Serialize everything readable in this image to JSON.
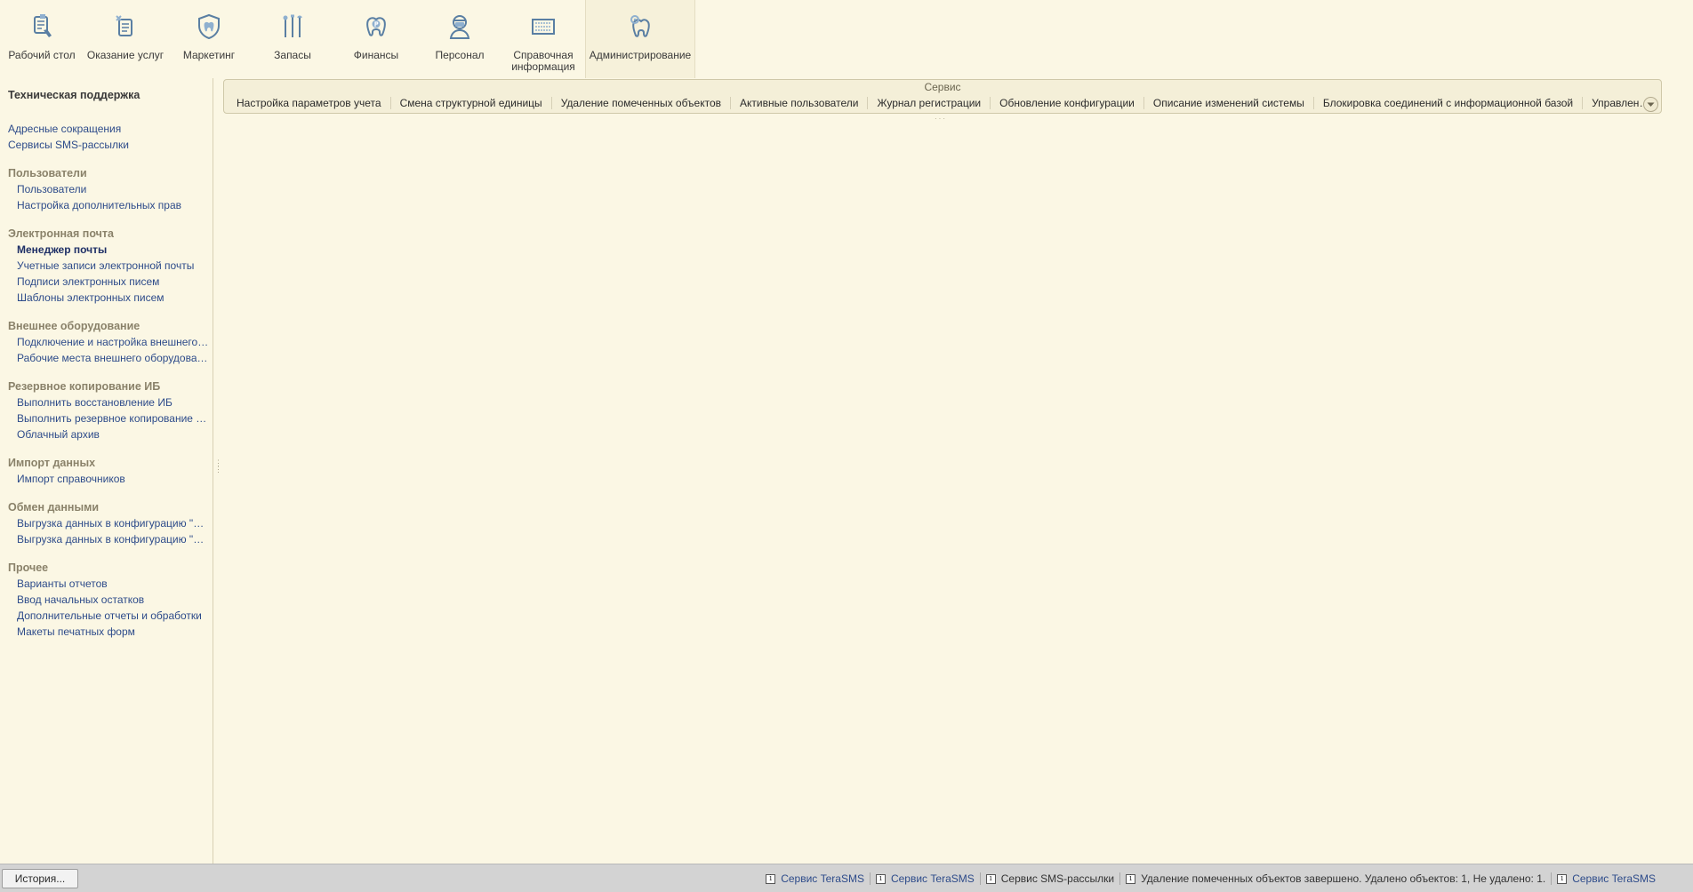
{
  "sections": [
    {
      "id": "desktop",
      "label": "Рабочий стол",
      "icon": "desktop-icon"
    },
    {
      "id": "services",
      "label": "Оказание услуг",
      "icon": "dental-services-icon"
    },
    {
      "id": "marketing",
      "label": "Маркетинг",
      "icon": "shield-tooth-icon"
    },
    {
      "id": "stock",
      "label": "Запасы",
      "icon": "dental-tools-icon"
    },
    {
      "id": "finance",
      "label": "Финансы",
      "icon": "finance-tooth-icon"
    },
    {
      "id": "staff",
      "label": "Персонал",
      "icon": "doctor-icon"
    },
    {
      "id": "reference",
      "label": "Справочная информация",
      "icon": "reference-panel-icon"
    },
    {
      "id": "admin",
      "label": "Администрирование",
      "icon": "admin-tooth-icon"
    }
  ],
  "active_section": "Администрирование",
  "nav": {
    "title": "Техническая поддержка",
    "top_links": [
      "Адресные сокращения",
      "Сервисы SMS-рассылки"
    ],
    "groups": [
      {
        "title": "Пользователи",
        "items": [
          "Пользователи",
          "Настройка дополнительных прав"
        ]
      },
      {
        "title": "Электронная почта",
        "items": [
          "Менеджер почты",
          "Учетные записи электронной почты",
          "Подписи электронных писем",
          "Шаблоны электронных писем"
        ]
      },
      {
        "title": "Внешнее оборудование",
        "items": [
          "Подключение и настройка внешнего об...",
          "Рабочие места внешнего оборудования"
        ]
      },
      {
        "title": "Резервное копирование ИБ",
        "items": [
          "Выполнить восстановление ИБ",
          "Выполнить резервное копирование ИБ",
          "Облачный архив"
        ]
      },
      {
        "title": "Импорт данных",
        "items": [
          "Импорт справочников"
        ]
      },
      {
        "title": "Обмен данными",
        "items": [
          "Выгрузка данных в конфигурацию \"Бух...",
          "Выгрузка данных в конфигурацию \"Бух..."
        ]
      },
      {
        "title": "Прочее",
        "items": [
          "Варианты отчетов",
          "Ввод начальных остатков",
          "Дополнительные отчеты и обработки",
          "Макеты печатных форм"
        ]
      }
    ],
    "bold_item": "Менеджер почты"
  },
  "service": {
    "title": "Сервис",
    "items": [
      "Настройка параметров учета",
      "Смена структурной единицы",
      "Удаление помеченных объектов",
      "Активные пользователи",
      "Журнал регистрации",
      "Обновление конфигурации",
      "Описание изменений системы",
      "Блокировка соединений с информационной базой",
      "Управление итогами и агрег..."
    ]
  },
  "statusbar": {
    "history_label": "История...",
    "notes": [
      {
        "text": "Сервис TeraSMS",
        "link": true
      },
      {
        "text": "Сервис TeraSMS",
        "link": true
      },
      {
        "text": "Сервис SMS-рассылки",
        "link": false
      },
      {
        "text": "Удаление помеченных объектов завершено. Удалено объектов: 1, Не удалено: 1.",
        "link": false
      },
      {
        "text": "Сервис TeraSMS",
        "link": true
      }
    ],
    "info_glyph": "i"
  },
  "colors": {
    "background": "#fbf7e4",
    "link": "#2d4b8a",
    "group_title": "#8a826a",
    "statusbar": "#d3d3d3"
  }
}
